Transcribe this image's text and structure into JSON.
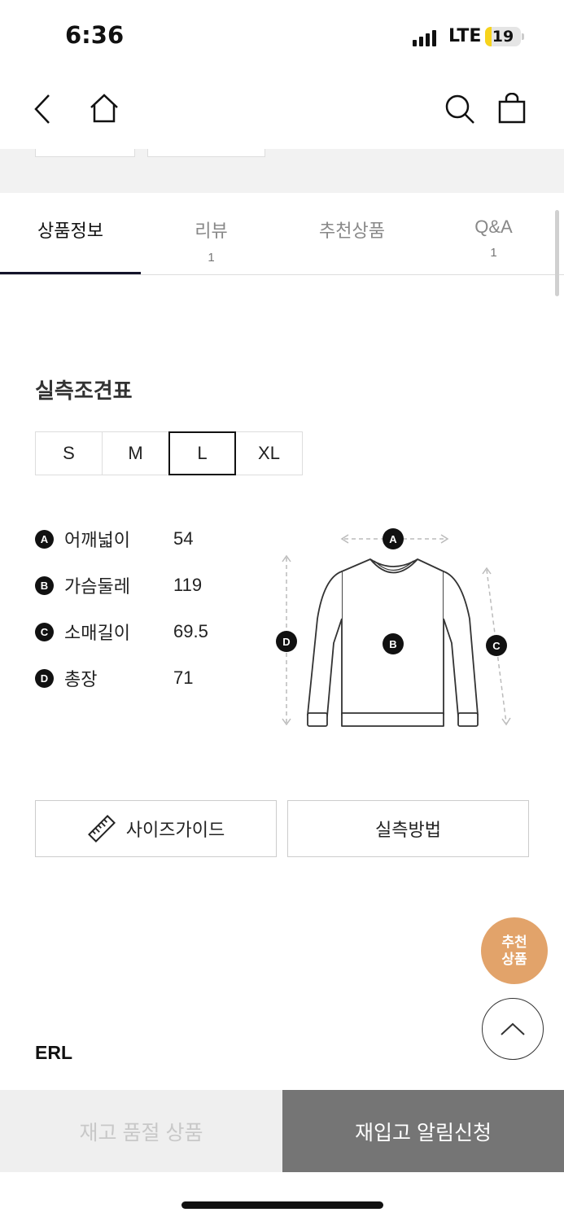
{
  "status_bar": {
    "time": "6:36",
    "network": "LTE",
    "battery": "19",
    "battery_level": 0.19
  },
  "nav": {
    "back_icon": "chevron-left-icon",
    "home_icon": "home-icon",
    "search_icon": "search-icon",
    "cart_icon": "shopping-bag-icon"
  },
  "tabs": [
    {
      "label": "상품정보",
      "count": ""
    },
    {
      "label": "리뷰",
      "count": "1"
    },
    {
      "label": "추천상품",
      "count": ""
    },
    {
      "label": "Q&A",
      "count": "1"
    }
  ],
  "size_chart": {
    "title": "실측조견표",
    "sizes": [
      "S",
      "M",
      "L",
      "XL"
    ],
    "selected": "L",
    "measurements": [
      {
        "badge": "A",
        "label": "어깨넓이",
        "value": "54"
      },
      {
        "badge": "B",
        "label": "가슴둘레",
        "value": "119"
      },
      {
        "badge": "C",
        "label": "소매길이",
        "value": "69.5"
      },
      {
        "badge": "D",
        "label": "총장",
        "value": "71"
      }
    ]
  },
  "buttons": {
    "size_guide": "사이즈가이드",
    "measure_method": "실측방법"
  },
  "brand": "ERL",
  "floating": {
    "recommend_line1": "추천",
    "recommend_line2": "상품"
  },
  "bottom_bar": {
    "soldout": "재고 품절 상품",
    "restock": "재입고 알림신청"
  },
  "colors": {
    "accent_recommend": "#e2a36a",
    "restock_bg": "#757575",
    "tab_underline": "#14142a"
  }
}
